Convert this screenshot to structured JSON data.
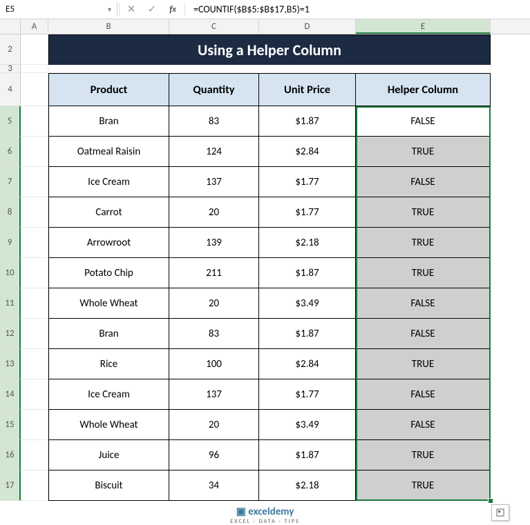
{
  "nameBox": "E5",
  "formulaBar": "=COUNTIF($B$5:$B$17,B5)=1",
  "columns": [
    "A",
    "B",
    "C",
    "D",
    "E"
  ],
  "title": "Using a Helper Column",
  "headers": {
    "b": "Product",
    "c": "Quantity",
    "d": "Unit Price",
    "e": "Helper Column"
  },
  "rows": [
    {
      "n": 5,
      "b": "Bran",
      "c": "83",
      "d": "$1.87",
      "e": "FALSE"
    },
    {
      "n": 6,
      "b": "Oatmeal Raisin",
      "c": "124",
      "d": "$2.84",
      "e": "TRUE"
    },
    {
      "n": 7,
      "b": "Ice Cream",
      "c": "137",
      "d": "$1.77",
      "e": "FALSE"
    },
    {
      "n": 8,
      "b": "Carrot",
      "c": "20",
      "d": "$1.77",
      "e": "TRUE"
    },
    {
      "n": 9,
      "b": "Arrowroot",
      "c": "139",
      "d": "$2.18",
      "e": "TRUE"
    },
    {
      "n": 10,
      "b": "Potato Chip",
      "c": "211",
      "d": "$1.87",
      "e": "TRUE"
    },
    {
      "n": 11,
      "b": "Whole Wheat",
      "c": "20",
      "d": "$3.49",
      "e": "FALSE"
    },
    {
      "n": 12,
      "b": "Bran",
      "c": "83",
      "d": "$1.87",
      "e": "FALSE"
    },
    {
      "n": 13,
      "b": "Rice",
      "c": "100",
      "d": "$2.84",
      "e": "TRUE"
    },
    {
      "n": 14,
      "b": "Ice Cream",
      "c": "137",
      "d": "$1.77",
      "e": "FALSE"
    },
    {
      "n": 15,
      "b": "Whole Wheat",
      "c": "20",
      "d": "$3.49",
      "e": "FALSE"
    },
    {
      "n": 16,
      "b": "Juice",
      "c": "96",
      "d": "$1.87",
      "e": "TRUE"
    },
    {
      "n": 17,
      "b": "Biscuit",
      "c": "34",
      "d": "$2.18",
      "e": "TRUE"
    }
  ],
  "logo": {
    "name": "exceldemy",
    "sub": "EXCEL · DATA · TIPS"
  }
}
